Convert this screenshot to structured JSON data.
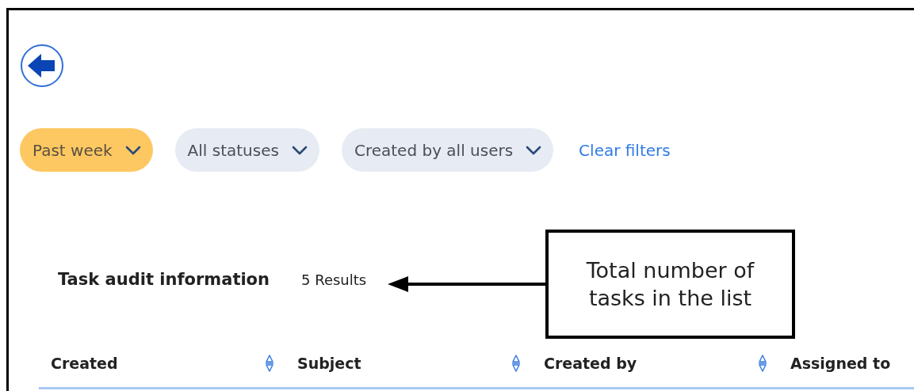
{
  "filters": [
    {
      "label": "Past week",
      "active": true
    },
    {
      "label": "All statuses",
      "active": false
    },
    {
      "label": "Created by all users",
      "active": false
    }
  ],
  "clear_filters": "Clear filters",
  "section": {
    "title": "Task audit information",
    "result_count": "5 Results"
  },
  "table": {
    "columns": [
      {
        "label": "Created",
        "sortable": true
      },
      {
        "label": "Subject",
        "sortable": true
      },
      {
        "label": "Created by",
        "sortable": true
      },
      {
        "label": "Assigned to",
        "sortable": false
      }
    ]
  },
  "annotation": {
    "text": "Total number of tasks in the list"
  }
}
